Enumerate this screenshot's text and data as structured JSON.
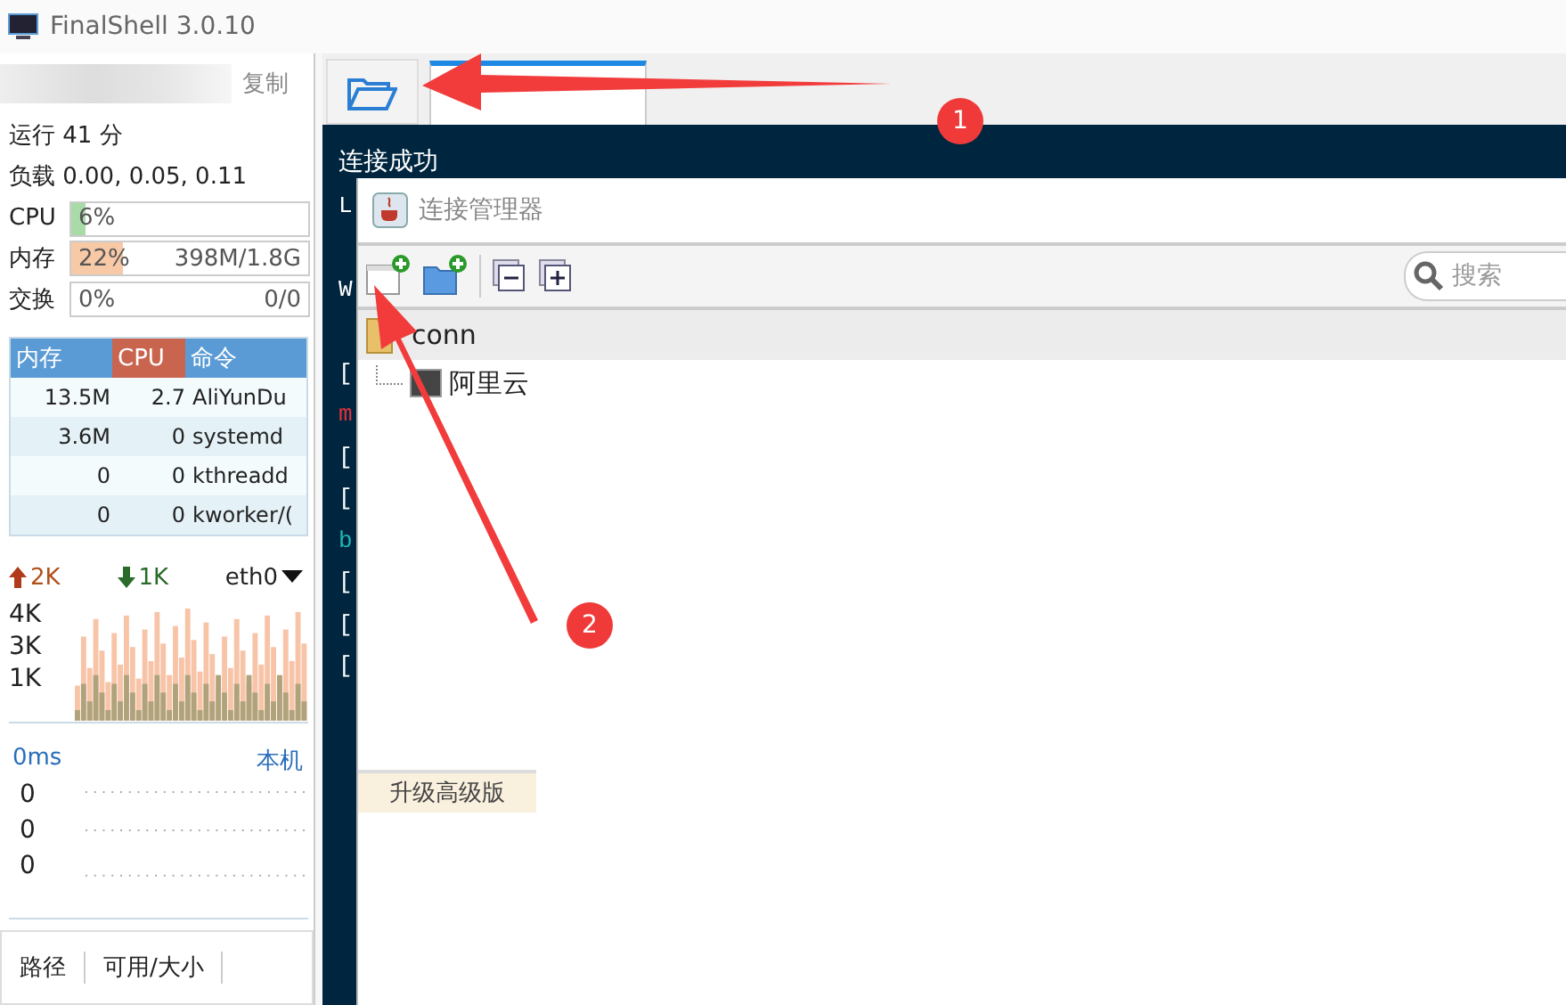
{
  "window": {
    "title": "FinalShell 3.0.10"
  },
  "sidebar": {
    "copy_label": "复制",
    "uptime": "运行 41 分",
    "load": "负载 0.00, 0.05, 0.11",
    "meters": [
      {
        "label": "CPU",
        "kind": "cpu",
        "level": 0.06,
        "reading": "6%"
      },
      {
        "label": "内存",
        "kind": "mem",
        "level": 0.22,
        "reading": "22%",
        "detail": "398M/1.8G"
      },
      {
        "label": "交换",
        "kind": "swap",
        "level": 0,
        "reading": "0%",
        "detail": "0/0"
      }
    ],
    "process_table": {
      "columns": [
        {
          "label": "内存",
          "selected": false
        },
        {
          "label": "CPU",
          "selected": true
        },
        {
          "label": "命令",
          "selected": false
        }
      ],
      "rows": [
        [
          "13.5M",
          "2.7",
          "AliYunDu"
        ],
        [
          "3.6M",
          "0",
          "systemd"
        ],
        [
          "0",
          "0",
          "kthreadd"
        ],
        [
          "0",
          "0",
          "kworker/("
        ]
      ]
    },
    "network": {
      "upload": "2K",
      "download": "1K",
      "interface": "eth0",
      "y_labels": [
        "4K",
        "3K",
        "1K"
      ]
    },
    "latency": {
      "value": "0ms",
      "host": "本机",
      "y_labels": [
        "0",
        "0",
        "0"
      ]
    },
    "disk_table": {
      "columns": [
        "路径",
        "可用/大小"
      ]
    }
  },
  "tabs": [
    {
      "selected": true
    }
  ],
  "terminal": {
    "blocks": [
      [
        {
          "text": "连接成功",
          "kind": "normal"
        },
        {
          "text": "L",
          "kind": "normal"
        }
      ],
      [
        {
          "text": "W",
          "kind": "normal"
        }
      ],
      [
        {
          "text": "[",
          "kind": "normal"
        },
        {
          "text": "m",
          "kind": "error"
        },
        {
          "text": "[",
          "kind": "normal"
        },
        {
          "text": "[",
          "kind": "normal"
        },
        {
          "text": "b",
          "kind": "accent"
        },
        {
          "text": "[",
          "kind": "normal"
        },
        {
          "text": "[",
          "kind": "normal"
        },
        {
          "text": "[",
          "kind": "normal"
        }
      ]
    ]
  },
  "dialog": {
    "title": "连接管理器",
    "search_placeholder": "搜索",
    "tree": [
      {
        "label": "conn",
        "children": [
          {
            "label": "阿里云"
          }
        ]
      }
    ],
    "upgrade_button": "升级高级版"
  },
  "annotations": [
    {
      "number": "1"
    },
    {
      "number": "2"
    }
  ]
}
